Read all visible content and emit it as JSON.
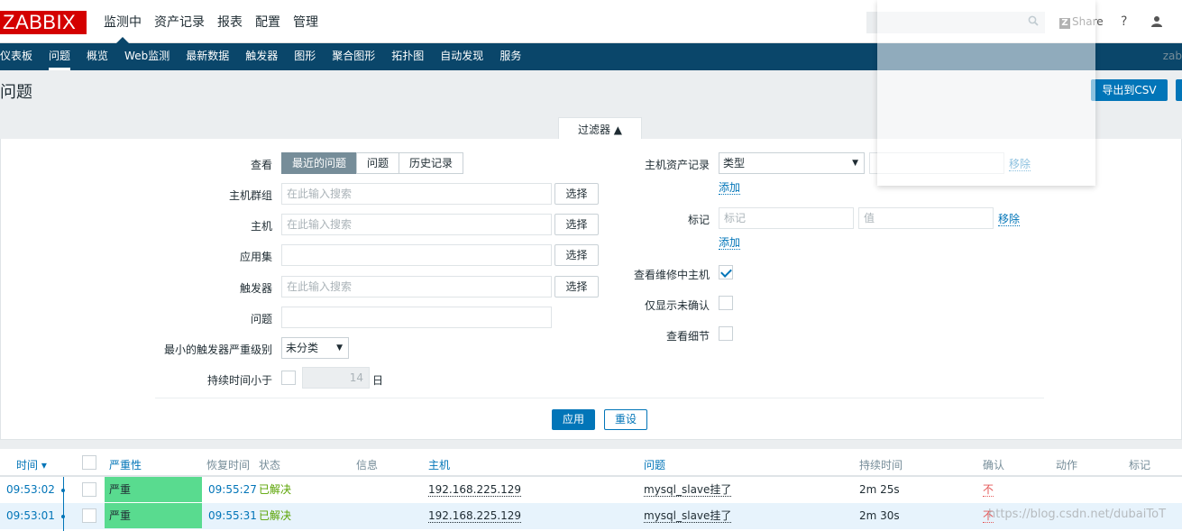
{
  "app": {
    "logo": "ZABBIX"
  },
  "topmenu": [
    "监测中",
    "资产记录",
    "报表",
    "配置",
    "管理"
  ],
  "share": "Share",
  "help": "?",
  "subnav": [
    "仪表板",
    "问题",
    "概览",
    "Web监测",
    "最新数据",
    "触发器",
    "图形",
    "聚合图形",
    "拓扑图",
    "自动发现",
    "服务"
  ],
  "subnav_user": "zab",
  "page_title": "问题",
  "export_csv": "导出到CSV",
  "filter_tab": "过滤器 ▲",
  "filter": {
    "view_label": "查看",
    "view_options": [
      "最近的问题",
      "问题",
      "历史记录"
    ],
    "host_group_label": "主机群组",
    "host_label": "主机",
    "app_label": "应用集",
    "trigger_label": "触发器",
    "problem_label": "问题",
    "min_severity_label": "最小的触发器严重级别",
    "min_severity_value": "未分类",
    "duration_label": "持续时间小于",
    "duration_value": "14",
    "duration_unit": "日",
    "placeholder": "在此输入搜索",
    "select_btn": "选择",
    "inventory_label": "主机资产记录",
    "inventory_type": "类型",
    "remove": "移除",
    "add": "添加",
    "tags_label": "标记",
    "tag_placeholder": "标记",
    "value_placeholder": "值",
    "maintenance_label": "查看维修中主机",
    "unack_label": "仅显示未确认",
    "details_label": "查看细节",
    "apply": "应用",
    "reset": "重设"
  },
  "table": {
    "headers": {
      "time": "时间 ▾",
      "severity": "严重性",
      "recovery": "恢复时间",
      "status": "状态",
      "info": "信息",
      "host": "主机",
      "problem": "问题",
      "duration": "持续时间",
      "ack": "确认",
      "actions": "动作",
      "tags": "标记"
    },
    "rows": [
      {
        "time": "09:53:02",
        "severity": "严重",
        "recovery": "09:55:27",
        "status": "已解决",
        "host": "192.168.225.129",
        "problem": "mysql_slave挂了",
        "duration": "2m 25s",
        "ack": "不"
      },
      {
        "time": "09:53:01",
        "severity": "严重",
        "recovery": "09:55:31",
        "status": "已解决",
        "host": "192.168.225.129",
        "problem": "mysql_slave挂了",
        "duration": "2m 30s",
        "ack": "不"
      }
    ]
  },
  "watermark": "https://blog.csdn.net/dubaiToT",
  "colors": {
    "nav": "#0a466a",
    "accent": "#0275b8",
    "high": "#59db8f",
    "resolved": "#59a300"
  }
}
